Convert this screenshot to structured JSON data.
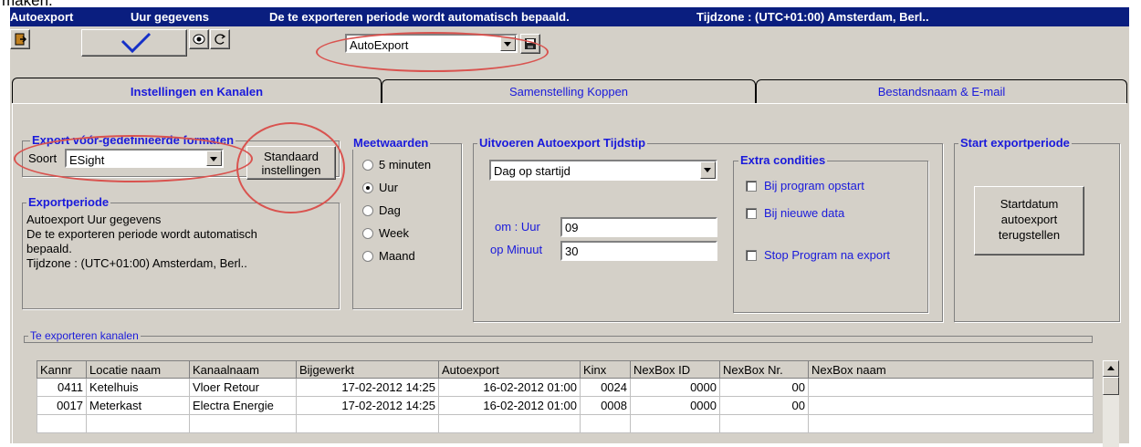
{
  "cut_text": "maken.",
  "titlebar": {
    "app": "Autoexport",
    "section": "Uur gegevens",
    "info": "De te exporteren periode wordt automatisch bepaald.",
    "timezone": "Tijdzone : (UTC+01:00) Amsterdam, Berl.."
  },
  "toolbar": {
    "profile_value": "AutoExport"
  },
  "tabs": [
    {
      "label": "Instellingen en Kanalen",
      "active": true
    },
    {
      "label": "Samenstelling Koppen",
      "active": false
    },
    {
      "label": "Bestandsnaam & E-mail",
      "active": false
    }
  ],
  "export_formats": {
    "title": "Export vóór-gedefinieerde formaten",
    "soort_label": "Soort",
    "soort_value": "ESight",
    "standard_button": "Standaard instellingen"
  },
  "export_period": {
    "title": "Exportperiode",
    "line1": "Autoexport Uur gegevens",
    "line2": "De te exporteren periode wordt automatisch",
    "line3": "bepaald.",
    "line4": "Tijdzone : (UTC+01:00) Amsterdam, Berl.."
  },
  "meetwaarden": {
    "title": "Meetwaarden",
    "options": [
      "5 minuten",
      "Uur",
      "Dag",
      "Week",
      "Maand"
    ],
    "selected_index": 1
  },
  "uitvoeren": {
    "title": "Uitvoeren Autoexport Tijdstip",
    "schedule_value": "Dag op startijd",
    "hour_label": "om : Uur",
    "hour_value": "09",
    "minute_label": "op Minuut",
    "minute_value": "30"
  },
  "extra": {
    "title": "Extra condities",
    "bij_program": "Bij program opstart",
    "bij_data": "Bij nieuwe data",
    "stop": "Stop Program na export"
  },
  "start_period": {
    "title": "Start exportperiode",
    "button_line1": "Startdatum",
    "button_line2": "autoexport",
    "button_line3": "terugstellen"
  },
  "channels": {
    "title": "Te exporteren kanalen",
    "columns": [
      "Kannr",
      "Locatie naam",
      "Kanaalnaam",
      "Bijgewerkt",
      "Autoexport",
      "Kinx",
      "NexBox ID",
      "NexBox Nr.",
      "NexBox naam"
    ],
    "rows": [
      [
        "0411",
        "Ketelhuis",
        "Vloer Retour",
        "17-02-2012 14:25",
        "16-02-2012 01:00",
        "0024",
        "0000",
        "00",
        ""
      ],
      [
        "0017",
        "Meterkast",
        "Electra Energie",
        "17-02-2012 14:25",
        "16-02-2012 01:00",
        "0008",
        "0000",
        "00",
        ""
      ]
    ]
  }
}
